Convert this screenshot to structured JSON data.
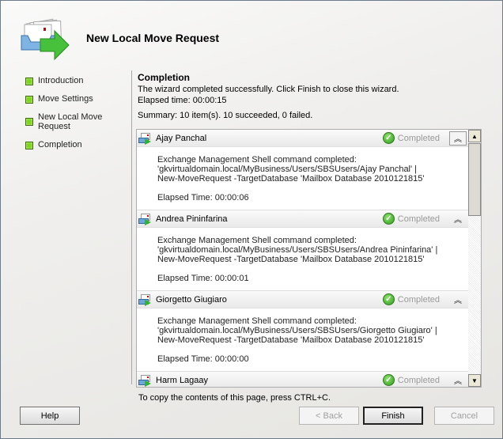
{
  "window": {
    "title": "New Local Move Request"
  },
  "nav": {
    "items": [
      {
        "label": "Introduction"
      },
      {
        "label": "Move Settings"
      },
      {
        "label": "New Local Move Request"
      },
      {
        "label": "Completion"
      }
    ]
  },
  "content": {
    "heading": "Completion",
    "message": "The wizard completed successfully. Click Finish to close this wizard.",
    "elapsed": "Elapsed time: 00:00:15",
    "summary": "Summary: 10 item(s). 10 succeeded, 0 failed.",
    "items": [
      {
        "name": "Ajay Panchal",
        "status": "Completed",
        "lines": [
          "Exchange Management Shell command completed:",
          "'gkvirtualdomain.local/MyBusiness/Users/SBSUsers/Ajay Panchal' |",
          "New-MoveRequest -TargetDatabase 'Mailbox Database 2010121815'"
        ],
        "elapsed": "Elapsed Time: 00:00:06"
      },
      {
        "name": "Andrea Pininfarina",
        "status": "Completed",
        "lines": [
          "Exchange Management Shell command completed:",
          "'gkvirtualdomain.local/MyBusiness/Users/SBSUsers/Andrea Pininfarina' |",
          "New-MoveRequest -TargetDatabase 'Mailbox Database 2010121815'"
        ],
        "elapsed": "Elapsed Time: 00:00:01"
      },
      {
        "name": "Giorgetto Giugiaro",
        "status": "Completed",
        "lines": [
          "Exchange Management Shell command completed:",
          "'gkvirtualdomain.local/MyBusiness/Users/SBSUsers/Giorgetto Giugiaro' |",
          "New-MoveRequest -TargetDatabase 'Mailbox Database 2010121815'"
        ],
        "elapsed": "Elapsed Time: 00:00:00"
      },
      {
        "name": "Harm Lagaay",
        "status": "Completed"
      }
    ],
    "copy_hint": "To copy the contents of this page, press CTRL+C."
  },
  "buttons": {
    "help": "Help",
    "back": "< Back",
    "finish": "Finish",
    "cancel": "Cancel"
  }
}
